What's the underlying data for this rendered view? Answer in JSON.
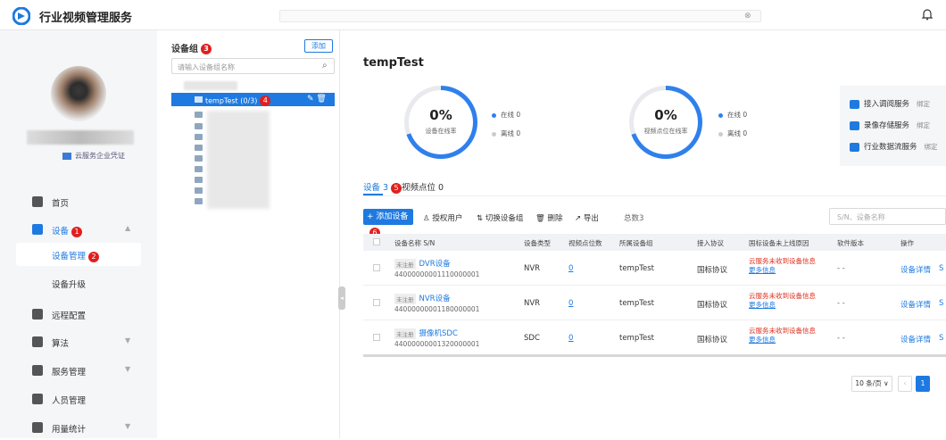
{
  "app": {
    "title": "行业视频管理服务"
  },
  "user": {
    "badge": "云服务企业凭证"
  },
  "nav": {
    "home": "首页",
    "device": "设备",
    "device_badge": "1",
    "device_mgmt": "设备管理",
    "device_mgmt_badge": "2",
    "device_upgrade": "设备升级",
    "remote_config": "远程配置",
    "algorithm": "算法",
    "service_mgmt": "服务管理",
    "personnel_mgmt": "人员管理",
    "usage_stats": "用量统计"
  },
  "groups": {
    "title": "设备组",
    "title_badge": "3",
    "add_label": "添加",
    "search_placeholder": "请输入设备组名称",
    "selected_label": "tempTest (0/3)",
    "selected_badge": "4"
  },
  "main": {
    "title": "tempTest",
    "device_ring": {
      "percent": "0%",
      "label": "设备在线率",
      "value": 0
    },
    "channel_ring": {
      "percent": "0%",
      "label": "视频点位在线率",
      "value": 0
    },
    "online_label": "在线 0",
    "offline_label": "离线 0",
    "services": [
      {
        "name": "接入调阅服务",
        "extra": "绑定"
      },
      {
        "name": "录像存储服务",
        "extra": "绑定"
      },
      {
        "name": "行业数据流服务",
        "extra": "绑定"
      }
    ],
    "colors": {
      "accent": "#1e7ae0",
      "error": "#e0301e"
    }
  },
  "tabs": {
    "devices": "设备 3",
    "devices_badge": "5",
    "channels": "视频点位 0"
  },
  "toolbar": {
    "add": "+ 添加设备",
    "add_badge": "6",
    "authorize": "授权用户",
    "switch_group": "切换设备组",
    "delete": "删除",
    "export": "导出",
    "total": "总数3",
    "search_placeholder": "S/N、设备名称"
  },
  "table": {
    "headers": {
      "name": "设备名称 S/N",
      "type": "设备类型",
      "channels": "视频点位数",
      "group": "所属设备组",
      "protocol": "接入协议",
      "reason": "国标设备未上线原因",
      "version": "软件版本",
      "ops": "操作"
    },
    "rows": [
      {
        "status": "未注册",
        "name": "DVR设备",
        "sn": "44000000001110000001",
        "type": "NVR",
        "channels": "0",
        "group": "tempTest",
        "protocol": "国标协议",
        "reason": "云服务未收到设备信息",
        "more": "更多信息",
        "version": "- -",
        "detail": "设备详情",
        "extra": "S"
      },
      {
        "status": "未注册",
        "name": "NVR设备",
        "sn": "44000000001180000001",
        "type": "NVR",
        "channels": "0",
        "group": "tempTest",
        "protocol": "国标协议",
        "reason": "云服务未收到设备信息",
        "more": "更多信息",
        "version": "- -",
        "detail": "设备详情",
        "extra": "S"
      },
      {
        "status": "未注册",
        "name": "摄像机SDC",
        "sn": "44000000001320000001",
        "type": "SDC",
        "channels": "0",
        "group": "tempTest",
        "protocol": "国标协议",
        "reason": "云服务未收到设备信息",
        "more": "更多信息",
        "version": "- -",
        "detail": "设备详情",
        "extra": "S"
      }
    ]
  },
  "pagination": {
    "page_size": "10 条/页",
    "current": "1"
  }
}
